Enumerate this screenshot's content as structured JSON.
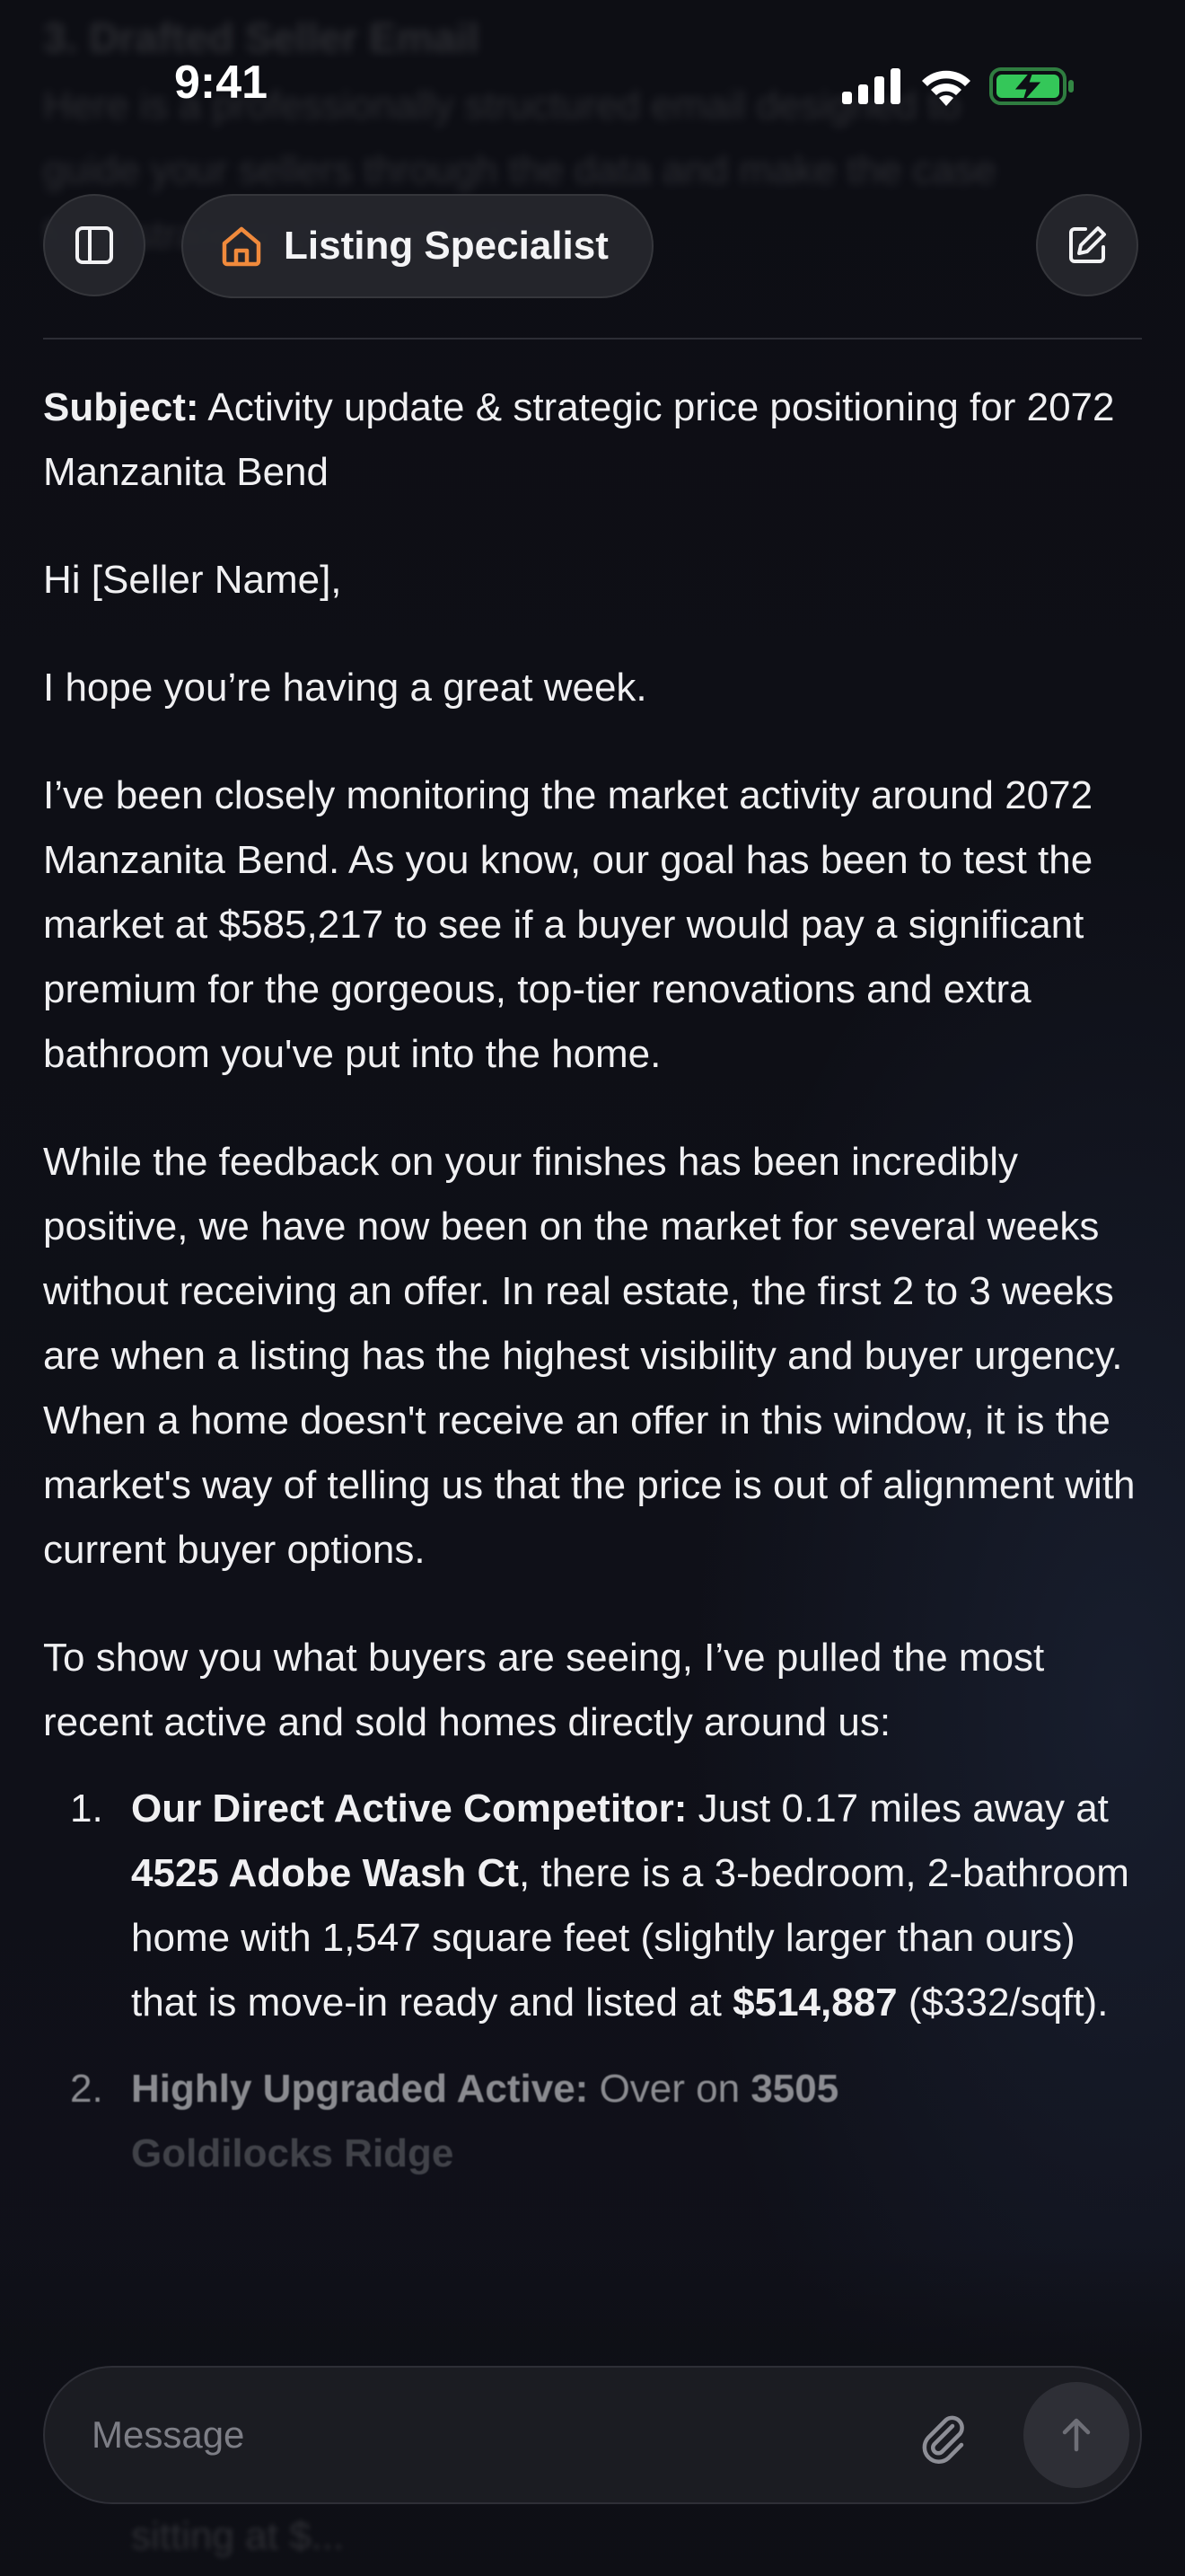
{
  "status_bar": {
    "time": "9:41"
  },
  "header": {
    "title": "Listing Specialist"
  },
  "ghost_text": {
    "heading": "3. Drafted Seller Email",
    "line1": "Here is a professionally structured email designed to",
    "line2": "guide your sellers through the data and make the case",
    "line3": "for a strategic price reduction."
  },
  "email": {
    "subject_label": "Subject:",
    "subject_text": " Activity update & strategic price positioning for 2072 Manzanita Bend",
    "greeting": "Hi [Seller Name],",
    "p1": "I hope you’re having a great week.",
    "p2": "I’ve been closely monitoring the market activity around 2072 Manzanita Bend. As you know, our goal has been to test the market at $585,217 to see if a buyer would pay a significant premium for the gorgeous, top-tier renovations and extra bathroom you've put into the home.",
    "p3": "While the feedback on your finishes has been incredibly positive, we have now been on the market for several weeks without receiving an offer. In real estate, the first 2 to 3 weeks are when a listing has the highest visibility and buyer urgency. When a home doesn't receive an offer in this window, it is the market's way of telling us that the price is out of alignment with current buyer options.",
    "p4": "To show you what buyers are seeing, I’ve pulled the most recent active and sold homes directly around us:",
    "items": [
      {
        "num": "1.",
        "label": "Our Direct Active Competitor:",
        "t1": " Just 0.17 miles away at ",
        "addr": "4525 Adobe Wash Ct",
        "t2": ", there is a 3-bedroom, 2-bathroom home with 1,547 square feet (slightly larger than ours) that is move-in ready and listed at ",
        "price": "$514,887",
        "t3": " ($332/sqft)."
      },
      {
        "num": "2.",
        "label": "Highly Upgraded Active:",
        "t1": " Over on ",
        "addr": "3505",
        "line2": "Goldilocks Ridge"
      }
    ],
    "trailing_ghost": "sitting at $..."
  },
  "composer": {
    "placeholder": "Message"
  }
}
